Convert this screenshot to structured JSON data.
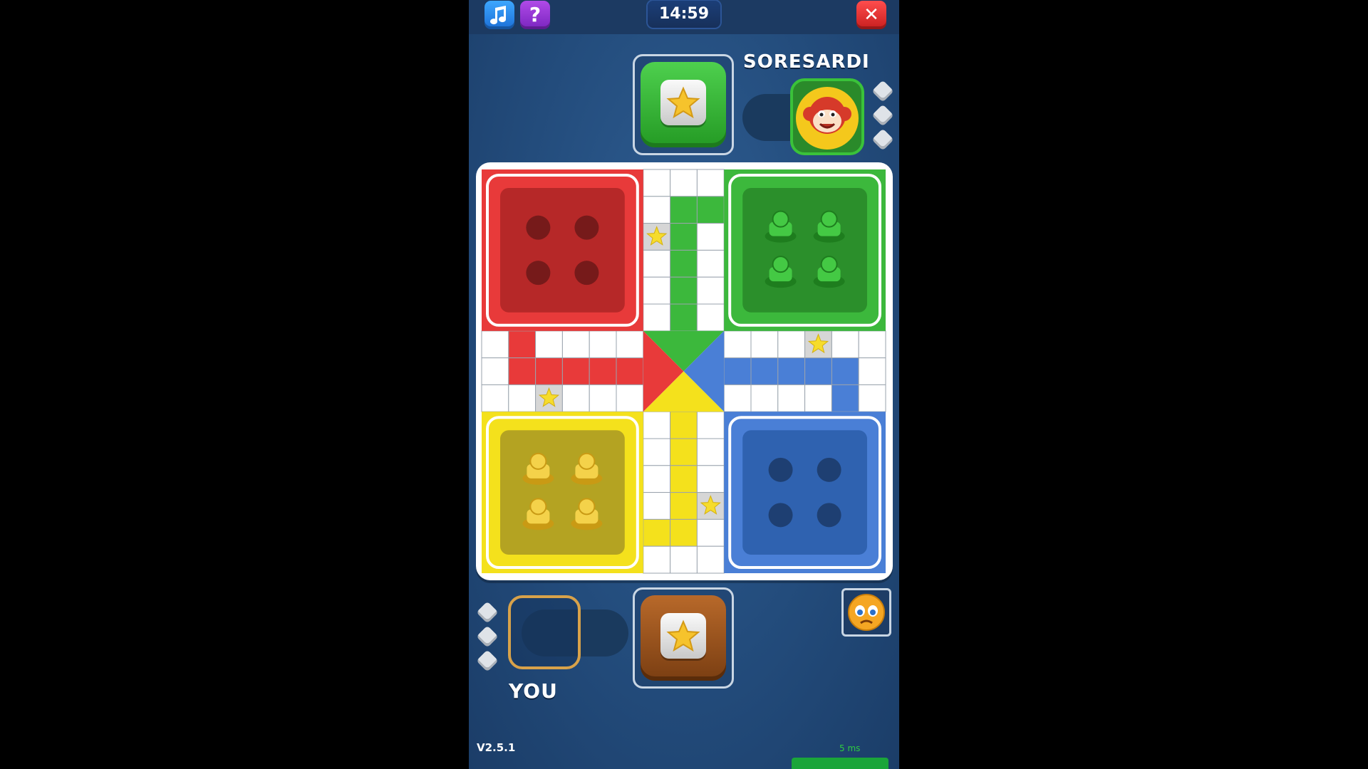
{
  "header": {
    "music_icon": "music-note-icon",
    "help_label": "?",
    "timer": "14:59",
    "close_label": "✕"
  },
  "opponent": {
    "name": "SORESARDI",
    "avatar": "monkey-avatar",
    "dice_remaining": 3
  },
  "player": {
    "name": "YOU",
    "dice_remaining": 3,
    "emoji_button": "sad-face-emoji"
  },
  "board": {
    "colors": {
      "red": "#e83a3a",
      "green": "#3cb83c",
      "yellow": "#f4e11c",
      "blue": "#4a7fd6"
    },
    "yard_pieces": {
      "red": 0,
      "green": 4,
      "yellow": 4,
      "blue": 0
    }
  },
  "footer": {
    "version": "V2.5.1",
    "ping": "5 ms"
  }
}
